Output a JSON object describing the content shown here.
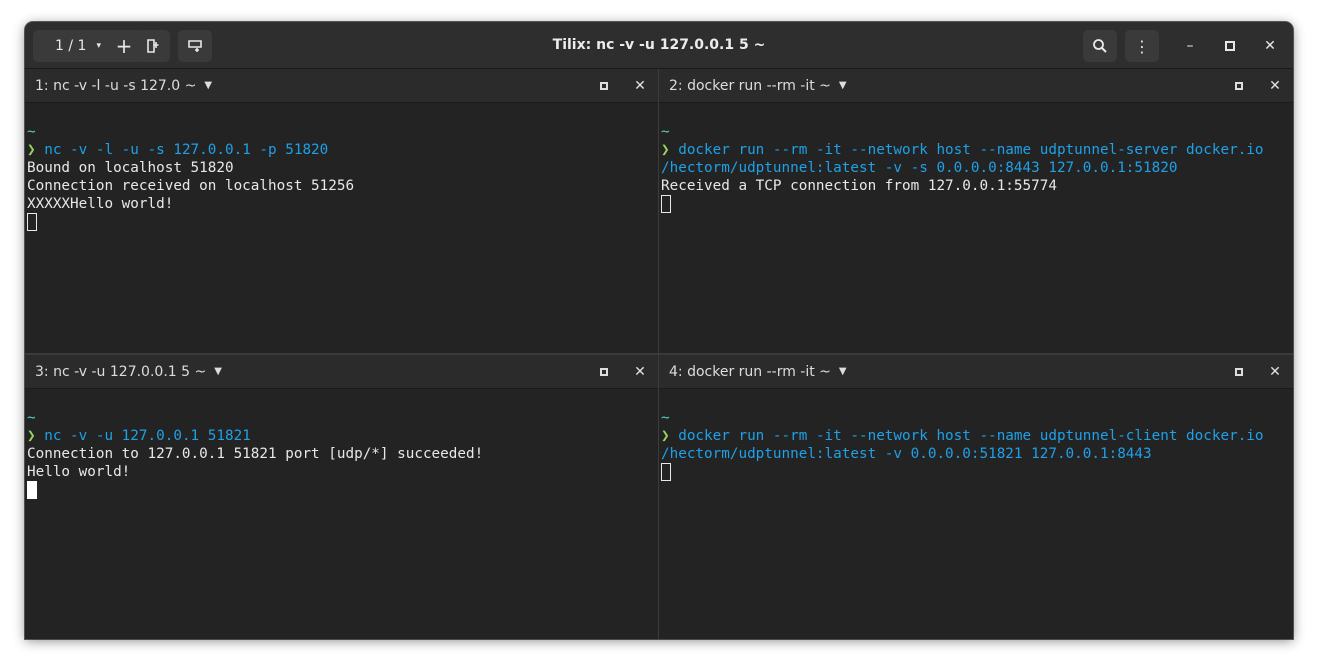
{
  "window": {
    "title": "Tilix: nc -v -u 127.0.0.1 5 ~",
    "session_label": "1 / 1",
    "icons": {
      "session_caret": "▾",
      "add": "+",
      "search": "search-icon",
      "menu": "⋮",
      "minimize": "–",
      "maximize": "□",
      "close": "✕"
    }
  },
  "panes": [
    {
      "title": "1: nc -v -l -u -s 127.0 ~",
      "lines": [
        {
          "tilde": "~"
        },
        {
          "prompt": "❯ ",
          "cmd": "nc -v -l -u -s 127.0.0.1 -p 51820"
        },
        {
          "text": "Bound on localhost 51820"
        },
        {
          "text": "Connection received on localhost 51256"
        },
        {
          "text": "XXXXXHello world!"
        }
      ],
      "cursor": "outline"
    },
    {
      "title": "2: docker run --rm -it  ~",
      "lines": [
        {
          "tilde": "~"
        },
        {
          "prompt": "❯ ",
          "cmd": "docker run --rm -it --network host --name udptunnel-server docker.io"
        },
        {
          "cmd": "/hectorm/udptunnel:latest -v -s 0.0.0.0:8443 127.0.0.1:51820"
        },
        {
          "text": "Received a TCP connection from 127.0.0.1:55774"
        }
      ],
      "cursor": "outline"
    },
    {
      "title": "3: nc -v -u 127.0.0.1 5 ~",
      "lines": [
        {
          "tilde": "~"
        },
        {
          "prompt": "❯ ",
          "cmd": "nc -v -u 127.0.0.1 51821"
        },
        {
          "text": "Connection to 127.0.0.1 51821 port [udp/*] succeeded!"
        },
        {
          "text": "Hello world!"
        }
      ],
      "cursor": "solid"
    },
    {
      "title": "4: docker run --rm -it  ~",
      "lines": [
        {
          "tilde": "~"
        },
        {
          "prompt": "❯ ",
          "cmd": "docker run --rm -it --network host --name udptunnel-client docker.io"
        },
        {
          "cmd": "/hectorm/udptunnel:latest -v 0.0.0.0:51821 127.0.0.1:8443"
        }
      ],
      "cursor": "outline"
    }
  ],
  "colors": {
    "background": "#232323",
    "headerbar": "#2e2e2e",
    "prompt": "#98d45a",
    "command": "#1ea1e8",
    "tilde": "#4fd6be",
    "text": "#e8e8e8"
  }
}
